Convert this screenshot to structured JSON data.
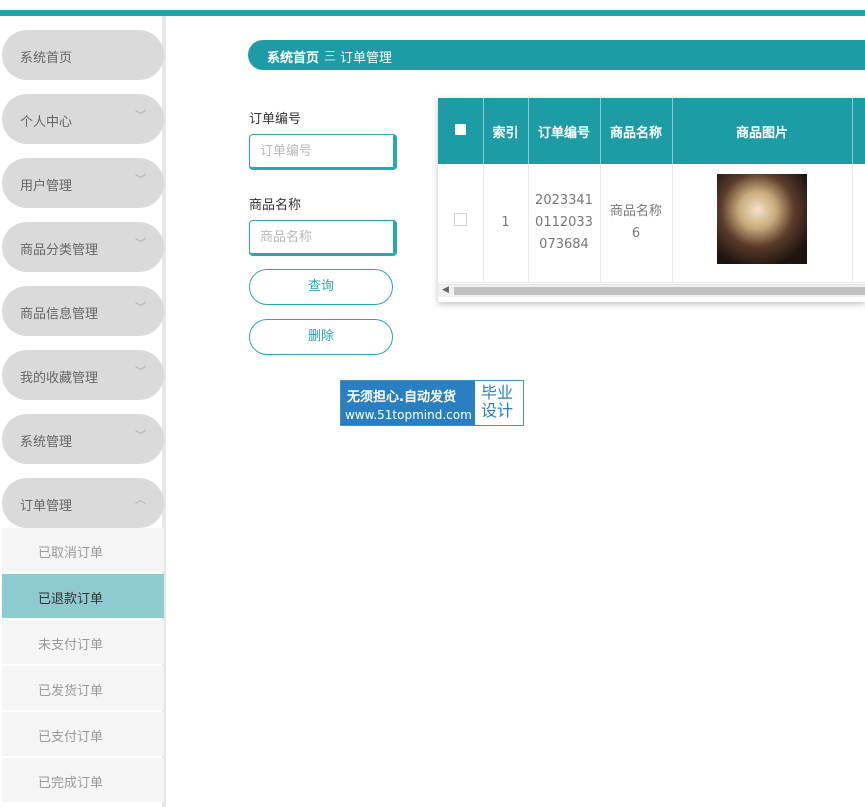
{
  "sidebar": {
    "items": [
      {
        "label": "系统首页",
        "chevron": ""
      },
      {
        "label": "个人中心",
        "chevron": "﹀"
      },
      {
        "label": "用户管理",
        "chevron": "﹀"
      },
      {
        "label": "商品分类管理",
        "chevron": "﹀"
      },
      {
        "label": "商品信息管理",
        "chevron": "﹀"
      },
      {
        "label": "我的收藏管理",
        "chevron": "﹀"
      },
      {
        "label": "系统管理",
        "chevron": "﹀"
      },
      {
        "label": "订单管理",
        "chevron": "︿"
      }
    ],
    "subitems": [
      {
        "label": "已取消订单"
      },
      {
        "label": "已退款订单",
        "active": true
      },
      {
        "label": "未支付订单"
      },
      {
        "label": "已发货订单"
      },
      {
        "label": "已支付订单"
      },
      {
        "label": "已完成订单"
      }
    ]
  },
  "breadcrumb": {
    "home": "系统首页",
    "separator": "三",
    "current": "订单管理"
  },
  "search": {
    "order_no_label": "订单编号",
    "order_no_placeholder": "订单编号",
    "product_name_label": "商品名称",
    "product_name_placeholder": "商品名称",
    "query_button": "查询",
    "delete_button": "删除"
  },
  "table": {
    "headers": [
      "索引",
      "订单编号",
      "商品名称",
      "商品图片"
    ],
    "rows": [
      {
        "index": "1",
        "order_no": "20233410112033073684",
        "product_name": "商品名称6"
      }
    ]
  },
  "banner": {
    "line1": "无须担心.自动发货",
    "line2": "www.51topmind.com",
    "right": "毕业设计"
  },
  "colors": {
    "accent": "#1d9ca6",
    "active_submenu": "#8dcbd1",
    "menu_bg": "#dadada"
  }
}
